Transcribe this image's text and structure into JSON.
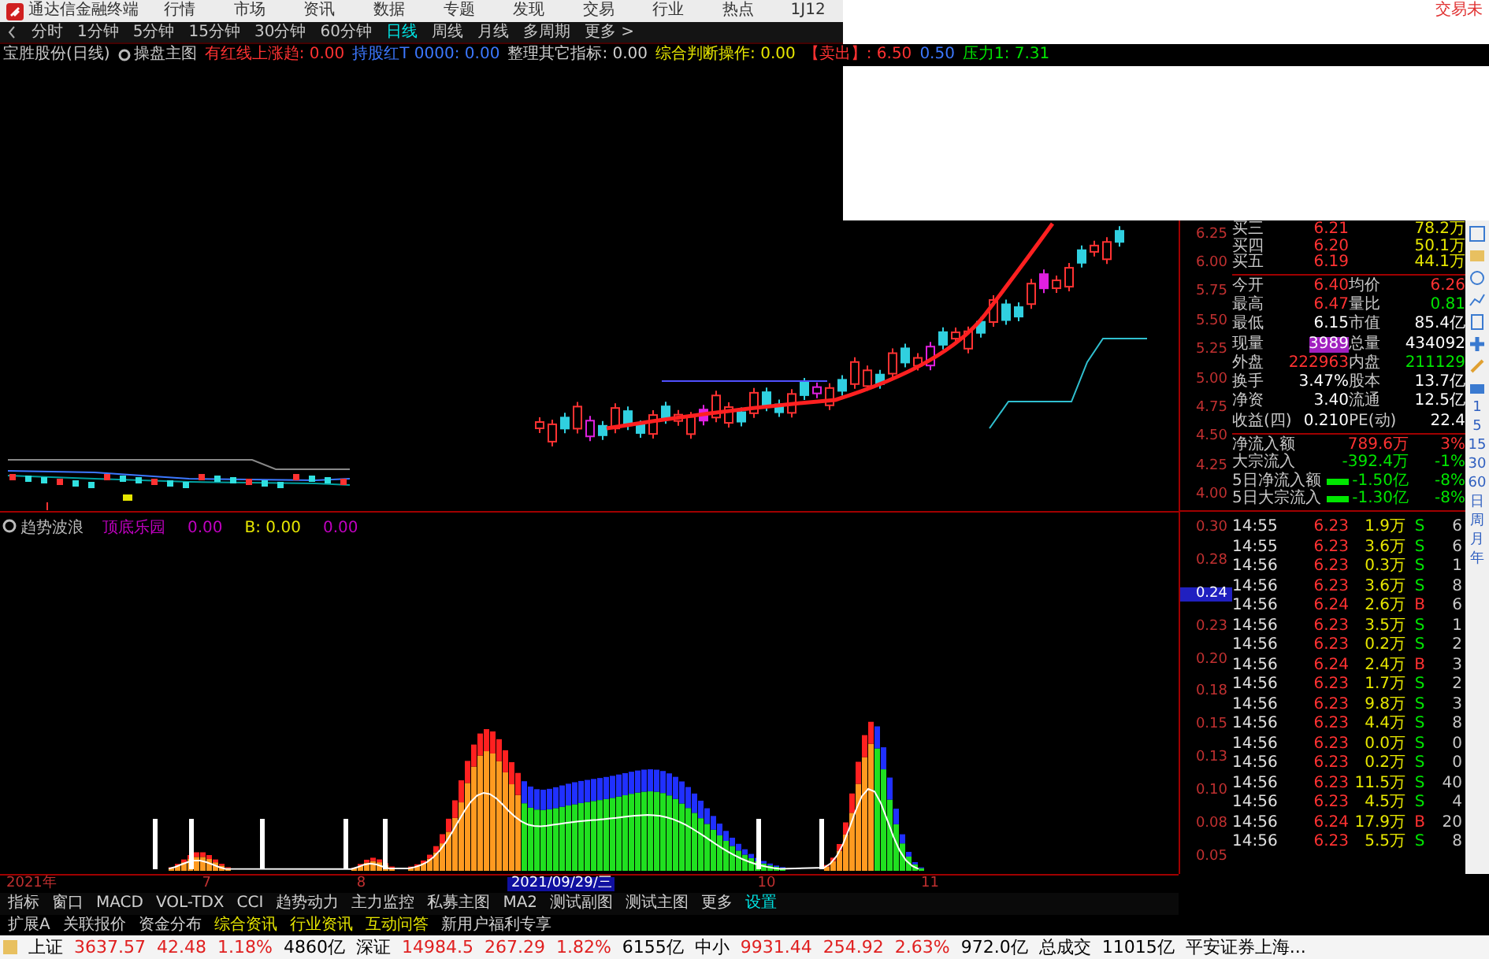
{
  "menu_bar": {
    "app_title": "通达信金融终端",
    "items": [
      "行情",
      "市场",
      "资讯",
      "数据",
      "专题",
      "发现",
      "交易",
      "行业",
      "热点",
      "1J12"
    ],
    "trade_link": "交易未"
  },
  "period_bar": {
    "items": [
      {
        "label": "分时",
        "selected": false
      },
      {
        "label": "1分钟",
        "selected": false
      },
      {
        "label": "5分钟",
        "selected": false
      },
      {
        "label": "15分钟",
        "selected": false
      },
      {
        "label": "30分钟",
        "selected": false
      },
      {
        "label": "60分钟",
        "selected": false
      },
      {
        "label": "日线",
        "selected": true
      },
      {
        "label": "周线",
        "selected": false
      },
      {
        "label": "月线",
        "selected": false
      },
      {
        "label": "多周期",
        "selected": false
      },
      {
        "label": "更多 >",
        "selected": false
      }
    ]
  },
  "indicator_line": {
    "stock": "宝胜股份(日线)",
    "main_chart": "操盘主图",
    "values": [
      {
        "label": "有红线上涨趋:",
        "value": "0.00",
        "color": "#ff3232"
      },
      {
        "label": "持股红T 0000:",
        "value": "0.00",
        "color": "#3c78ff"
      },
      {
        "label": "整理其它指标:",
        "value": "0.00",
        "color": "#d0d0d0"
      },
      {
        "label": "综合判断操作:",
        "value": "0.00",
        "color": "#e6e600"
      },
      {
        "label": "【卖出】:",
        "value": "6.50",
        "color": "#ff3232"
      },
      {
        "value": "0.50",
        "color": "#3c78ff"
      },
      {
        "label": "压力1:",
        "value": "7.31",
        "color": "#00e600"
      }
    ]
  },
  "sub_chart": {
    "title": "趋势波浪",
    "values": [
      {
        "text": "顶底乐园",
        "color": "#c000c0"
      },
      {
        "text": "0.00",
        "color": "#c000c0"
      },
      {
        "text": "B: 0.00",
        "color": "#e6e600"
      },
      {
        "text": "0.00",
        "color": "#c000c0"
      }
    ]
  },
  "price_axis": {
    "upper": [
      "6.25",
      "6.00",
      "5.75",
      "5.50",
      "5.25",
      "5.00",
      "4.75",
      "4.50",
      "4.25",
      "4.00"
    ],
    "lower": [
      {
        "label": "0.30",
        "selected": false
      },
      {
        "label": "0.28",
        "selected": false
      },
      {
        "label": "0.24",
        "selected": true
      },
      {
        "label": "0.23",
        "selected": false
      },
      {
        "label": "0.20",
        "selected": false
      },
      {
        "label": "0.18",
        "selected": false
      },
      {
        "label": "0.15",
        "selected": false
      },
      {
        "label": "0.13",
        "selected": false
      },
      {
        "label": "0.10",
        "selected": false
      },
      {
        "label": "0.08",
        "selected": false
      },
      {
        "label": "0.05",
        "selected": false
      }
    ]
  },
  "order_book": [
    {
      "label": "买三",
      "price": "6.21",
      "volume": "78.2万"
    },
    {
      "label": "买四",
      "price": "6.20",
      "volume": "50.1万"
    },
    {
      "label": "买五",
      "price": "6.19",
      "volume": "44.1万"
    }
  ],
  "stats": [
    {
      "label1": "今开",
      "value1": {
        "text": "6.40",
        "color": "#ff3232"
      },
      "label2": "均价",
      "value2": {
        "text": "6.26",
        "color": "#ff3232"
      }
    },
    {
      "label1": "最高",
      "value1": {
        "text": "6.47",
        "color": "#ff3232"
      },
      "label2": "量比",
      "value2": {
        "text": "0.81",
        "color": "#00e600"
      }
    },
    {
      "label1": "最低",
      "value1": {
        "text": "6.15",
        "color": "#ffffff"
      },
      "label2": "市值",
      "value2": {
        "text": "85.4亿",
        "color": "#ffffff"
      }
    },
    {
      "label1": "现量",
      "value1": {
        "text": "3989",
        "color": "#a020c0"
      },
      "label2": "总量",
      "value2": {
        "text": "434092",
        "color": "#ffffff"
      }
    },
    {
      "label1": "外盘",
      "value1": {
        "text": "222963",
        "color": "#ff3232"
      },
      "label2": "内盘",
      "value2": {
        "text": "211129",
        "color": "#00e600"
      }
    },
    {
      "label1": "换手",
      "value1": {
        "text": "3.47%",
        "color": "#ffffff"
      },
      "label2": "股本",
      "value2": {
        "text": "13.7亿",
        "color": "#ffffff"
      }
    },
    {
      "label1": "净资",
      "value1": {
        "text": "3.40",
        "color": "#ffffff"
      },
      "label2": "流通",
      "value2": {
        "text": "12.5亿",
        "color": "#ffffff"
      }
    },
    {
      "label1": "收益(四)",
      "value1": {
        "text": "0.210",
        "color": "#ffffff"
      },
      "label2": "PE(动)",
      "value2": {
        "text": "22.4",
        "color": "#ffffff"
      }
    }
  ],
  "fund_flow": [
    {
      "label": "净流入额",
      "kind": "plain",
      "value": "789.6万",
      "percent": "3%",
      "color": "#ff3232"
    },
    {
      "label": "大宗流入",
      "kind": "plain",
      "value": "-392.4万",
      "percent": "-1%",
      "color": "#00e600"
    },
    {
      "label": "5日净流入额",
      "kind": "bar",
      "value": "-1.50亿",
      "percent": "-8%",
      "color": "#00e600"
    },
    {
      "label": "5日大宗流入",
      "kind": "bar",
      "value": "-1.30亿",
      "percent": "-8%",
      "color": "#00e600"
    }
  ],
  "trades": [
    {
      "time": "14:55",
      "price": "6.23",
      "volume": "1.9万",
      "side": "S",
      "count": "6",
      "kind": "sell"
    },
    {
      "time": "14:55",
      "price": "6.23",
      "volume": "3.6万",
      "side": "S",
      "count": "6",
      "kind": "sell"
    },
    {
      "time": "14:56",
      "price": "6.23",
      "volume": "0.3万",
      "side": "S",
      "count": "1",
      "kind": "sell"
    },
    {
      "time": "14:56",
      "price": "6.23",
      "volume": "3.6万",
      "side": "S",
      "count": "8",
      "kind": "sell"
    },
    {
      "time": "14:56",
      "price": "6.24",
      "volume": "2.6万",
      "side": "B",
      "count": "6",
      "kind": "buy"
    },
    {
      "time": "14:56",
      "price": "6.23",
      "volume": "3.5万",
      "side": "S",
      "count": "1",
      "kind": "sell"
    },
    {
      "time": "14:56",
      "price": "6.23",
      "volume": "0.2万",
      "side": "S",
      "count": "2",
      "kind": "sell"
    },
    {
      "time": "14:56",
      "price": "6.24",
      "volume": "2.4万",
      "side": "B",
      "count": "3",
      "kind": "buy"
    },
    {
      "time": "14:56",
      "price": "6.23",
      "volume": "1.7万",
      "side": "S",
      "count": "2",
      "kind": "sell"
    },
    {
      "time": "14:56",
      "price": "6.23",
      "volume": "9.8万",
      "side": "S",
      "count": "3",
      "kind": "sell"
    },
    {
      "time": "14:56",
      "price": "6.23",
      "volume": "4.4万",
      "side": "S",
      "count": "8",
      "kind": "sell"
    },
    {
      "time": "14:56",
      "price": "6.23",
      "volume": "0.0万",
      "side": "S",
      "count": "0",
      "kind": "sell"
    },
    {
      "time": "14:56",
      "price": "6.23",
      "volume": "0.2万",
      "side": "S",
      "count": "0",
      "kind": "sell"
    },
    {
      "time": "14:56",
      "price": "6.23",
      "volume": "11.5万",
      "side": "S",
      "count": "40",
      "kind": "sell"
    },
    {
      "time": "14:56",
      "price": "6.23",
      "volume": "4.5万",
      "side": "S",
      "count": "4",
      "kind": "sell"
    },
    {
      "time": "14:56",
      "price": "6.24",
      "volume": "17.9万",
      "side": "B",
      "count": "20",
      "kind": "buy"
    },
    {
      "time": "14:56",
      "price": "6.23",
      "volume": "5.5万",
      "side": "S",
      "count": "8",
      "kind": "sell"
    }
  ],
  "side_toolbar": {
    "labels": [
      "1",
      "5",
      "15",
      "30",
      "60",
      "日",
      "周",
      "月",
      "年"
    ]
  },
  "date_axis": [
    {
      "label": "2021年",
      "selected": false
    },
    {
      "label": "7",
      "selected": false
    },
    {
      "label": "8",
      "selected": false
    },
    {
      "label": "2021/09/29/三",
      "selected": true
    },
    {
      "label": "10",
      "selected": false
    },
    {
      "label": "11",
      "selected": false
    }
  ],
  "indicator_tabs": [
    {
      "label": "指标",
      "selected": false
    },
    {
      "label": "窗口",
      "selected": false
    },
    {
      "label": "MACD",
      "selected": false
    },
    {
      "label": "VOL-TDX",
      "selected": false
    },
    {
      "label": "CCI",
      "selected": false
    },
    {
      "label": "趋势动力",
      "selected": false
    },
    {
      "label": "主力监控",
      "selected": false
    },
    {
      "label": "私募主图",
      "selected": false
    },
    {
      "label": "MA2",
      "selected": false
    },
    {
      "label": "测试副图",
      "selected": false
    },
    {
      "label": "测试主图",
      "selected": false
    },
    {
      "label": "更多",
      "selected": false
    },
    {
      "label": "设置",
      "selected": true
    }
  ],
  "extension_tabs": [
    {
      "label": "扩展A",
      "color": "#d0d0d0"
    },
    {
      "label": "关联报价",
      "color": "#d0d0d0"
    },
    {
      "label": "资金分布",
      "color": "#d0d0d0"
    },
    {
      "label": "综合资讯",
      "color": "#e6e600"
    },
    {
      "label": "行业资讯",
      "color": "#e6e600"
    },
    {
      "label": "互动问答",
      "color": "#e6e600"
    },
    {
      "label": "新用户福利专享",
      "color": "#d0d0d0"
    }
  ],
  "status_bar": [
    {
      "text": "上证",
      "color": "#000000"
    },
    {
      "text": "3637.57",
      "color": "#e02020"
    },
    {
      "text": "42.48",
      "color": "#e02020"
    },
    {
      "text": "1.18%",
      "color": "#e02020"
    },
    {
      "text": "4860亿",
      "color": "#000000"
    },
    {
      "text": "深证",
      "color": "#000000"
    },
    {
      "text": "14984.5",
      "color": "#e02020"
    },
    {
      "text": "267.29",
      "color": "#e02020"
    },
    {
      "text": "1.82%",
      "color": "#e02020"
    },
    {
      "text": "6155亿",
      "color": "#000000"
    },
    {
      "text": "中小",
      "color": "#000000"
    },
    {
      "text": "9931.44",
      "color": "#e02020"
    },
    {
      "text": "254.92",
      "color": "#e02020"
    },
    {
      "text": "2.63%",
      "color": "#e02020"
    },
    {
      "text": "972.0亿",
      "color": "#000000"
    },
    {
      "text": "总成交",
      "color": "#000000"
    },
    {
      "text": "11015亿",
      "color": "#000000"
    },
    {
      "text": "平安证券上海...",
      "color": "#000000"
    }
  ]
}
